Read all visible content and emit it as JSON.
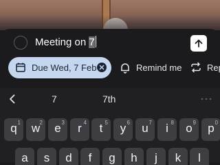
{
  "task_input": {
    "text_before": "Meeting on ",
    "selected_text": "7"
  },
  "options": {
    "due_label": "Due Wed, 7 Feb",
    "remind_label": "Remind me",
    "repeat_label": "Rep"
  },
  "keyboard": {
    "suggestions": [
      "7",
      "7th"
    ],
    "row1": [
      {
        "key": "q",
        "hint": "1"
      },
      {
        "key": "w",
        "hint": "2"
      },
      {
        "key": "e",
        "hint": "3"
      },
      {
        "key": "r",
        "hint": "4"
      },
      {
        "key": "t",
        "hint": "5"
      },
      {
        "key": "y",
        "hint": "6"
      },
      {
        "key": "u",
        "hint": "7"
      },
      {
        "key": "i",
        "hint": "8"
      },
      {
        "key": "o",
        "hint": "9"
      },
      {
        "key": "p",
        "hint": "0"
      }
    ],
    "row2": [
      "a",
      "s",
      "d",
      "f",
      "g",
      "h",
      "j",
      "k",
      "l"
    ]
  },
  "colors": {
    "sheet_background": "#1b1b1d",
    "due_chip": "#c5d7ef",
    "key_background": "#3e3e42"
  },
  "icons": [
    "checkbox-circle-icon",
    "send-arrow-up-icon",
    "calendar-icon",
    "clear-x-icon",
    "bell-icon",
    "repeat-icon",
    "chevron-left-icon",
    "more-dots-icon"
  ]
}
